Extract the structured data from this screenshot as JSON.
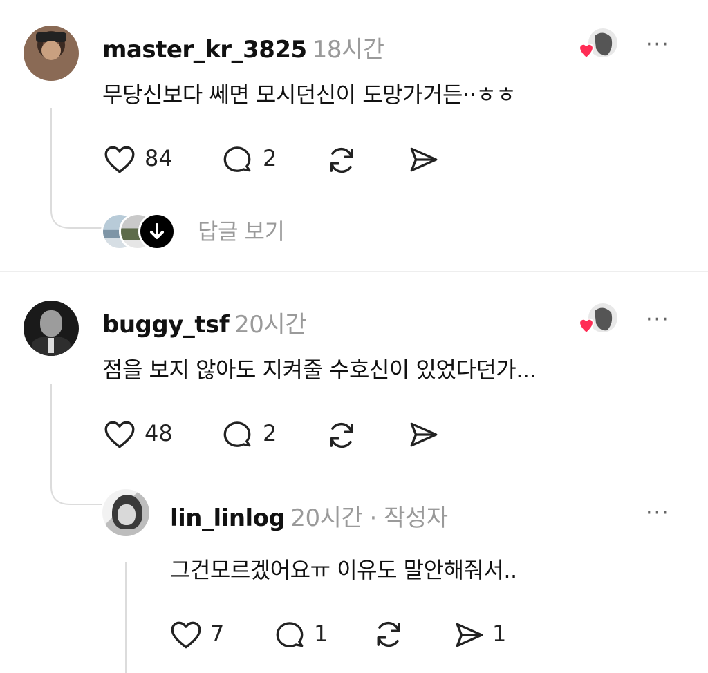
{
  "posts": [
    {
      "username": "master_kr_3825",
      "time": "18시간",
      "text": "무당신보다 쎄면 모시던신이 도망가거든··ㅎㅎ",
      "likes": "84",
      "comments": "2",
      "view_replies": "답글 보기"
    },
    {
      "username": "buggy_tsf",
      "time": "20시간",
      "text": "점을 보지 않아도 지켜줄 수호신이 있었다던가...",
      "likes": "48",
      "comments": "2"
    }
  ],
  "reply": {
    "username": "lin_linlog",
    "time": "20시간 · 작성자",
    "text": "그건모르겠어요ㅠ 이유도 말안해줘서..",
    "likes": "7",
    "comments": "1",
    "shares": "1"
  },
  "icons": {
    "more": "more-dots-icon",
    "like": "heart-icon",
    "comment": "comment-icon",
    "repost": "repost-icon",
    "share": "send-icon",
    "liked_by_author": "liked-by-author-badge",
    "expand": "chevron-down-icon"
  },
  "colors": {
    "heart": "#ff2d55",
    "muted": "#9a9a9a",
    "line": "#dcdcdc"
  }
}
